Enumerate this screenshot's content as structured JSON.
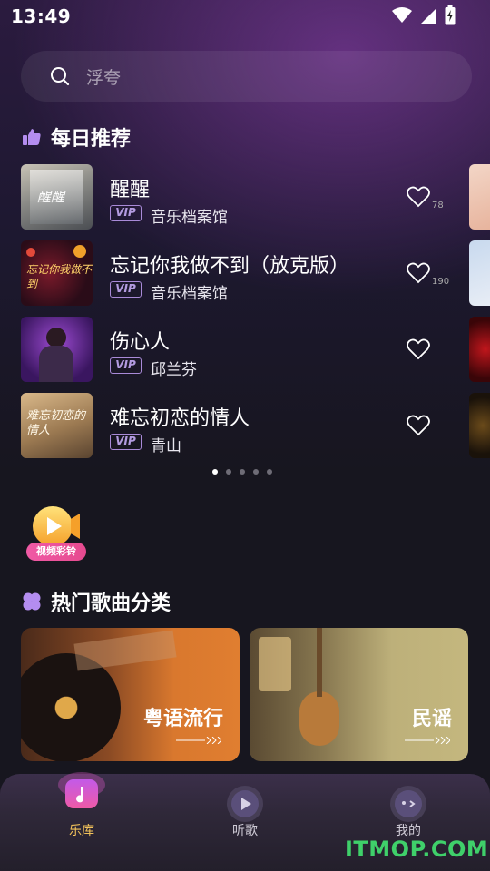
{
  "status_bar": {
    "time": "13:49"
  },
  "search": {
    "placeholder": "浮夸"
  },
  "daily": {
    "title": "每日推荐",
    "songs": [
      {
        "title": "醒醒",
        "vip": "VIP",
        "artist": "音乐档案馆",
        "likes": "78",
        "cover_text": "醒醒"
      },
      {
        "title": "忘记你我做不到（放克版）",
        "vip": "VIP",
        "artist": "音乐档案馆",
        "likes": "190",
        "cover_text": "忘记你我做不到"
      },
      {
        "title": "伤心人",
        "vip": "VIP",
        "artist": "邱兰芬",
        "likes": ""
      },
      {
        "title": "难忘初恋的情人",
        "vip": "VIP",
        "artist": "青山",
        "likes": "",
        "cover_text": "难忘初恋的情人"
      }
    ],
    "pages": 5,
    "active_page": 1
  },
  "video_ring": {
    "label": "视频彩铃"
  },
  "categories": {
    "title": "热门歌曲分类",
    "items": [
      {
        "label": "粤语流行"
      },
      {
        "label": "民谣"
      }
    ]
  },
  "tabs": [
    {
      "label": "乐库",
      "active": true
    },
    {
      "label": "听歌",
      "active": false
    },
    {
      "label": "我的",
      "active": false
    }
  ],
  "watermark": "ITMOP.COM",
  "colors": {
    "accent": "#f2c25a",
    "vip": "#b39be0",
    "watermark": "#3fd06a"
  }
}
